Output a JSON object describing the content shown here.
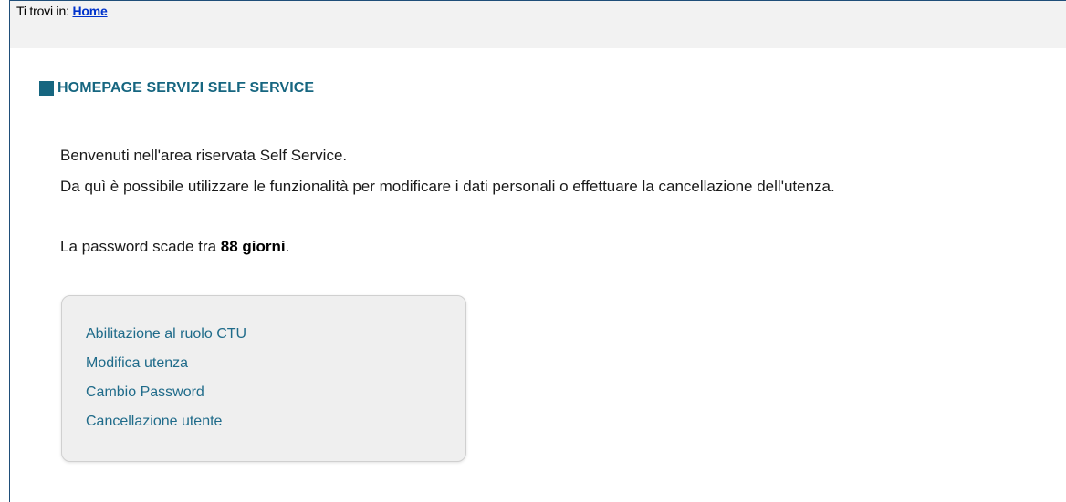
{
  "breadcrumb": {
    "prefix": "Ti trovi in:",
    "home_link": "Home"
  },
  "section": {
    "title": "HOMEPAGE SERVIZI SELF SERVICE"
  },
  "content": {
    "welcome": "Benvenuti nell'area riservata Self Service.",
    "description": "Da quì è possibile utilizzare le funzionalità per modificare i dati personali o effettuare la cancellazione dell'utenza.",
    "password_prefix": "La password scade tra",
    "password_days": "88 giorni",
    "password_suffix": "."
  },
  "menu": {
    "items": [
      {
        "label": "Abilitazione al ruolo CTU"
      },
      {
        "label": "Modifica utenza"
      },
      {
        "label": "Cambio Password"
      },
      {
        "label": "Cancellazione utente"
      }
    ]
  },
  "colors": {
    "accent": "#166680",
    "link": "#1f6b8a",
    "breadcrumb_link": "#0033cc",
    "frame_border": "#1f4e79"
  }
}
